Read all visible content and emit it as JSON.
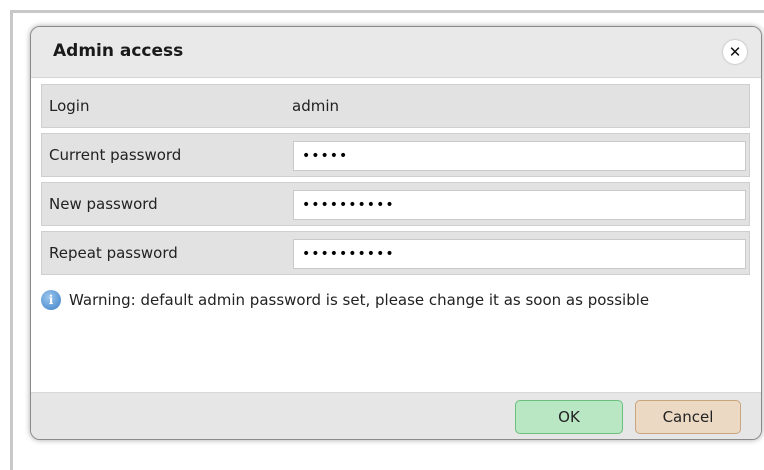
{
  "dialog": {
    "title": "Admin access",
    "close_glyph": "✕"
  },
  "rows": [
    {
      "label": "Login",
      "value": "admin"
    },
    {
      "label": "Current password",
      "value": "•••••"
    },
    {
      "label": "New password",
      "value": "••••••••••"
    },
    {
      "label": "Repeat password",
      "value": "••••••••••"
    }
  ],
  "warning": {
    "icon": "info-icon",
    "icon_glyph": "i",
    "text": "Warning: default admin password is set, please change it as soon as possible"
  },
  "buttons": {
    "ok_label": "OK",
    "cancel_label": "Cancel"
  },
  "colors": {
    "ok_bg": "#b9e6c3",
    "cancel_bg": "#ecd9c4",
    "title_bar": "#e9e9e9",
    "row_bg": "#e2e2e2"
  }
}
